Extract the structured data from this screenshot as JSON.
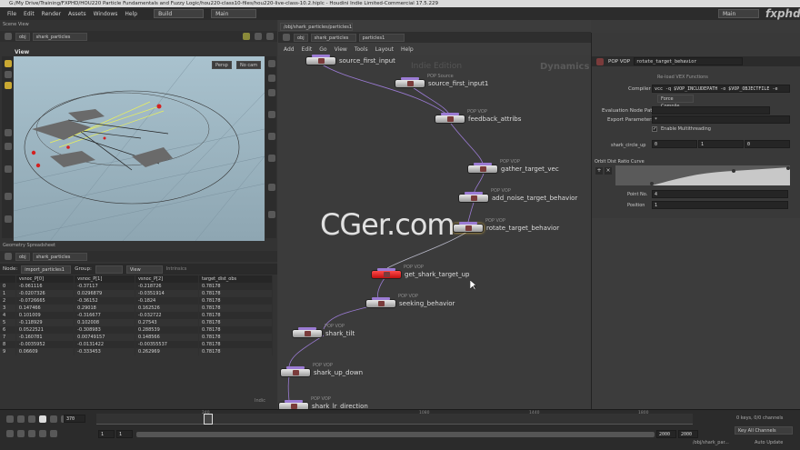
{
  "window": {
    "title": "G:/My Drive/Training/FXPHD/HOU220 Particle Fundamentals and Fuzzy Logic/hou220-class10-files/hou220-live-class-10.2.hiplc - Houdini Indie Limited-Commercial 17.5.229"
  },
  "menu": [
    "File",
    "Edit",
    "Render",
    "Assets",
    "Windows",
    "Help"
  ],
  "desktop": {
    "build": "Build",
    "desk": "Main",
    "right": "Main"
  },
  "watermark": "CGer.com",
  "logo": "fxphd",
  "scene_view": {
    "pane_label": "Scene View",
    "path_root": "obj",
    "path_node": "shark_particles",
    "tab": "View",
    "persp": "Persp",
    "cam": "No cam"
  },
  "spreadsheet": {
    "pane_label": "Geometry Spreadsheet",
    "path_root": "obj",
    "path_node": "shark_particles",
    "node_label": "Node:",
    "node_value": "import_particles1",
    "group_label": "Group:",
    "view_label": "View",
    "intrinsics": "Intrinsics",
    "columns": [
      "",
      "vsnoc_P[0]",
      "vsnoc_P[1]",
      "vsnoc_P[2]",
      "target_dist_obs"
    ],
    "rows": [
      [
        "0",
        "-0.061116",
        "-0.37117",
        "-0.218726",
        "0.78178"
      ],
      [
        "1",
        "-0.0207326",
        "0.0296879",
        "-0.0351914",
        "0.78178"
      ],
      [
        "2",
        "-0.0726665",
        "-0.36152",
        "-0.1824",
        "0.78178"
      ],
      [
        "3",
        "0.147466",
        "0.29018",
        "0.162526",
        "0.78178"
      ],
      [
        "4",
        "0.101009",
        "-0.316677",
        "-0.032722",
        "0.78178"
      ],
      [
        "5",
        "-0.118929",
        "0.102008",
        "0.27543",
        "0.78178"
      ],
      [
        "6",
        "0.0522521",
        "-0.308983",
        "0.288539",
        "0.78178"
      ],
      [
        "7",
        "-0.160781",
        "0.00749157",
        "0.148566",
        "0.78178"
      ],
      [
        "8",
        "-0.0035952",
        "-0.0131422",
        "-0.00355537",
        "0.78178"
      ],
      [
        "9",
        "0.06609",
        "-0.333453",
        "0.262969",
        "0.78178"
      ]
    ],
    "footer": "Indic"
  },
  "network": {
    "tab": "/obj/shark_particles/particles1",
    "path_root": "obj",
    "path_node": "shark_particles",
    "path_leaf": "particles1",
    "menu": [
      "Add",
      "Edit",
      "Go",
      "View",
      "Tools",
      "Layout",
      "Help"
    ],
    "edition": "Indie Edition",
    "context": "Dynamics",
    "nodes": [
      {
        "type": "",
        "label": "source_first_input"
      },
      {
        "type": "POP Source",
        "label": "source_first_input1"
      },
      {
        "type": "POP VOP",
        "label": "feedback_attribs"
      },
      {
        "type": "POP VOP",
        "label": "gather_target_vec"
      },
      {
        "type": "POP VOP",
        "label": "add_noise_target_behavior"
      },
      {
        "type": "POP VOP",
        "label": "rotate_target_behavior"
      },
      {
        "type": "POP VOP",
        "label": "get_shark_target_up"
      },
      {
        "type": "POP VOP",
        "label": "seeking_behavior"
      },
      {
        "type": "POP VOP",
        "label": "shark_tilt"
      },
      {
        "type": "POP VOP",
        "label": "shark_up_down"
      },
      {
        "type": "POP VOP",
        "label": "shark_lr_direction"
      }
    ]
  },
  "params": {
    "type": "POP VOP",
    "name": "rotate_target_behavior",
    "reload_label": "Re-load VEX Functions",
    "compiler_label": "Compiler",
    "compiler_value": "vcc -q $VOP_INCLUDEPATH -o $VOP_OBJECTFILE -e",
    "force_compile": "Force Compile",
    "eval_path_label": "Evaluation Node Path",
    "export_label": "Export Parameters",
    "export_value": "*",
    "multithread": "Enable Multithreading",
    "shark_circle_label": "shark_circle_up",
    "shark_circle_values": [
      "0",
      "1",
      "0"
    ],
    "ramp_label": "Orbit Dist Ratio Curve",
    "point_label": "Point No.",
    "point_value": "4",
    "position_label": "Position",
    "position_value": "1"
  },
  "timeline": {
    "frame": "370",
    "ticks": [
      "240",
      "1080",
      "1440",
      "1800"
    ],
    "start": "1",
    "start2": "1",
    "end": "2000",
    "end2": "2000",
    "keys": "0 keys, 0/0 channels",
    "key_all": "Key All Channels",
    "path": "/obj/shark_par...",
    "update": "Auto Update"
  },
  "colors": {
    "selected_node": "#e02020",
    "wire": "#9b7bd4",
    "viewport_bg": "#9fb7c3"
  }
}
